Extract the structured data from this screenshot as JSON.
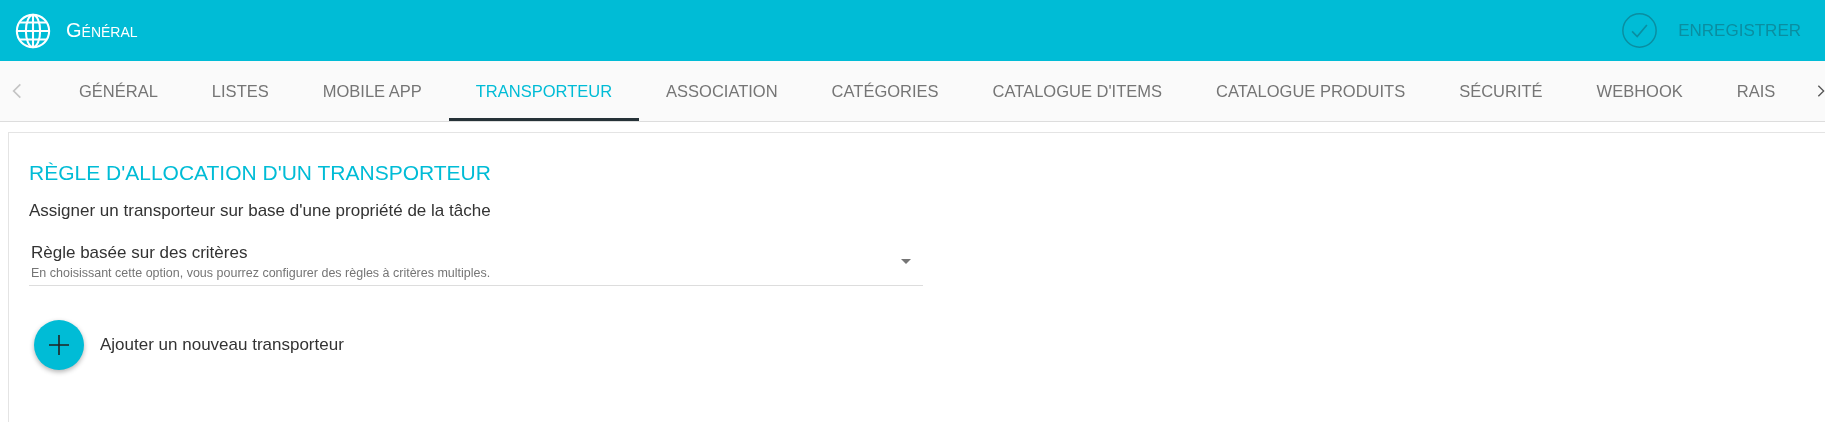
{
  "header": {
    "title": "Général",
    "save_button": {
      "label": "ENREGISTRER",
      "disabled": true
    }
  },
  "tabs": [
    {
      "label": "GÉNÉRAL",
      "selected": false
    },
    {
      "label": "LISTES",
      "selected": false
    },
    {
      "label": "MOBILE APP",
      "selected": false
    },
    {
      "label": "TRANSPORTEUR",
      "selected": true
    },
    {
      "label": "ASSOCIATION",
      "selected": false
    },
    {
      "label": "CATÉGORIES",
      "selected": false
    },
    {
      "label": "CATALOGUE D'ITEMS",
      "selected": false
    },
    {
      "label": "CATALOGUE PRODUITS",
      "selected": false
    },
    {
      "label": "SÉCURITÉ",
      "selected": false
    },
    {
      "label": "WEBHOOK",
      "selected": false
    },
    {
      "label": "RAIS",
      "selected": false
    }
  ],
  "section": {
    "title": "RÈGLE D'ALLOCATION D'UN TRANSPORTEUR",
    "description": "Assigner un transporteur sur base d'une propriété de la tâche",
    "rule_select": {
      "value": "Règle basée sur des critères",
      "hint": "En choisissant cette option, vous pourrez configurer des règles à critères multiples."
    },
    "add_button": {
      "label": "Ajouter un nouveau transporteur"
    }
  }
}
